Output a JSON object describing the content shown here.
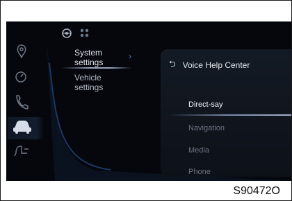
{
  "menu": {
    "items": [
      {
        "label_lines": [
          "System",
          "settings"
        ],
        "selected": true
      },
      {
        "label_lines": [
          "Vehicle",
          "settings"
        ],
        "selected": false
      }
    ]
  },
  "icons": {
    "top": [
      "steering-wheel-icon",
      "grid-icon"
    ],
    "rail": [
      "location-icon",
      "speedometer-icon",
      "phone-icon",
      "car-icon",
      "seat-icon"
    ],
    "arrow": "chevron-right-icon",
    "back": "back-arrow-icon"
  },
  "panel": {
    "title": "Voice Help Center",
    "items": [
      {
        "label": "Direct-say",
        "selected": true
      },
      {
        "label": "Navigation",
        "selected": false
      },
      {
        "label": "Media",
        "selected": false
      },
      {
        "label": "Phone",
        "selected": false
      }
    ]
  },
  "figure_code": "S90472O",
  "colors": {
    "screen_bg": "#05070c",
    "accent": "#5a7fb6",
    "text_active": "#f2f6fb",
    "text_dim": "#6b7380"
  }
}
